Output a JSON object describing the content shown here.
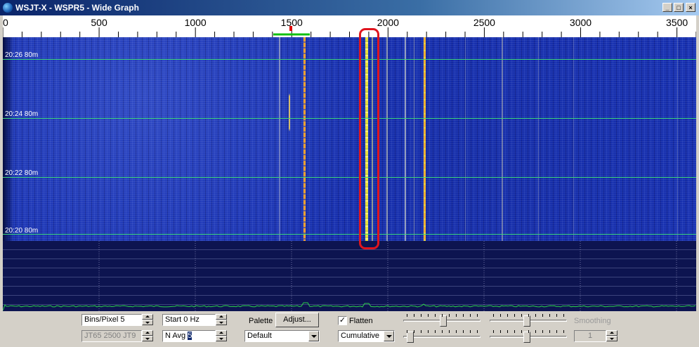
{
  "window": {
    "title": "WSJT-X - WSPR5 - Wide Graph",
    "minimize_label": "_",
    "maximize_label": "□",
    "close_label": "×"
  },
  "freq_scale": {
    "min": 0,
    "max": 3600,
    "labels": [
      "500",
      "1000",
      "1500",
      "2000",
      "2500",
      "3000",
      "3500"
    ],
    "left_edge_label": "0"
  },
  "waterfall": {
    "time_labels": [
      "20:26  80m",
      "20:24  80m",
      "20:22  80m",
      "20:20  80m"
    ]
  },
  "controls": {
    "bins_per_pixel": "Bins/Pixel  5",
    "mode_label": "JT65  2500  JT9",
    "start": "Start 0 Hz",
    "n_avg_prefix": "N Avg ",
    "n_avg_value": "5",
    "palette_label": "Palette",
    "adjust_label": "Adjust...",
    "palette_value": "Default",
    "flatten_label": "Flatten",
    "flatten_checked": "✓",
    "spectrum_mode": "Cumulative",
    "smoothing_label": "Smoothing",
    "smoothing_value": "1"
  },
  "colors": {
    "waterfall_bg": "#1730b0",
    "signal_yellow": "#e8e040",
    "signal_orange": "#f0a030",
    "highlight_red": "#e0141e",
    "grid_green": "#3fd87a",
    "spectrum_green": "#2bd14a"
  }
}
